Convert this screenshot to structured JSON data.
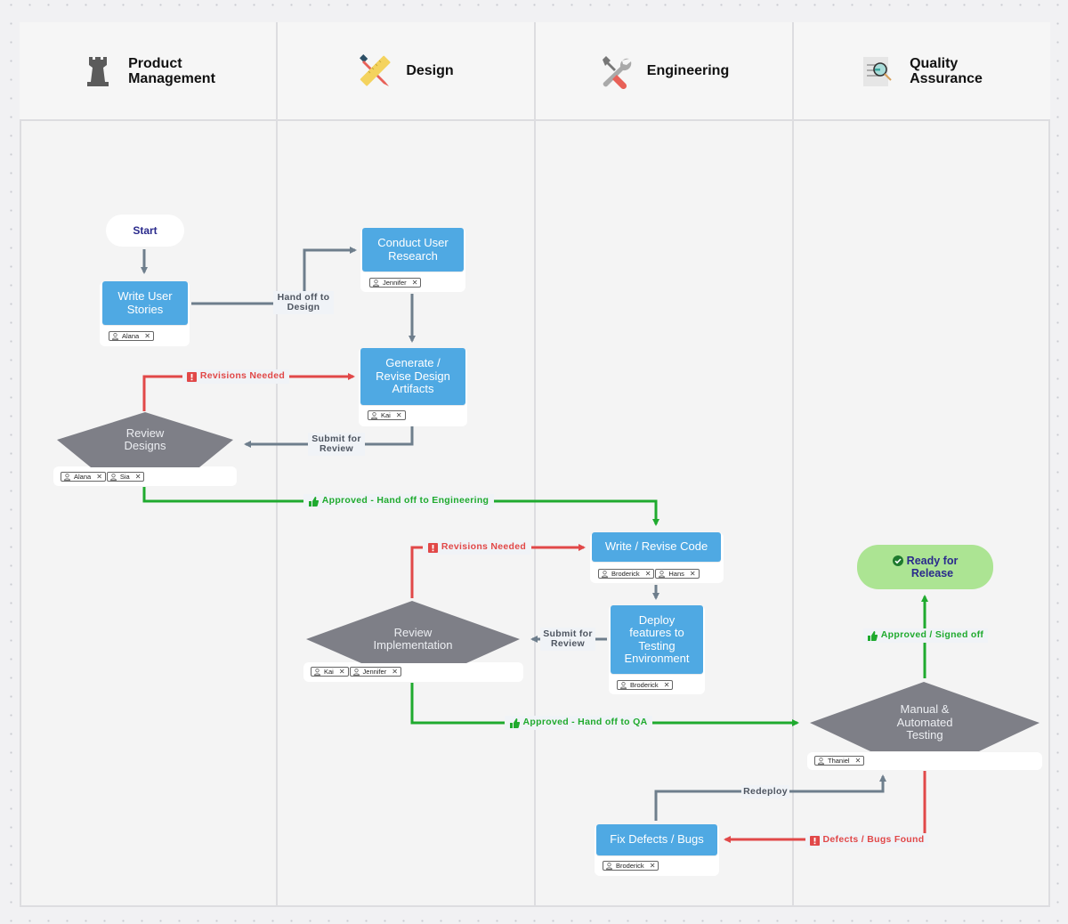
{
  "lanes": [
    {
      "title": "Product\nManagement",
      "icon": "chess-rook-icon"
    },
    {
      "title": "Design",
      "icon": "ruler-pencil-icon"
    },
    {
      "title": "Engineering",
      "icon": "wrench-screwdriver-icon"
    },
    {
      "title": "Quality\nAssurance",
      "icon": "document-magnifier-icon"
    }
  ],
  "colors": {
    "process": "#4fa9e3",
    "decision": "#7e7f87",
    "connector": "#6e7e8c",
    "reject": "#e14848",
    "approve": "#1faa2e",
    "done": "#ace493"
  },
  "nodes": {
    "start": {
      "label": "Start"
    },
    "write_user_stories": {
      "label": "Write User\nStories",
      "assignees": [
        "Alana"
      ]
    },
    "conduct_user_research": {
      "label": "Conduct User\nResearch",
      "assignees": [
        "Jennifer"
      ]
    },
    "generate_design": {
      "label": "Generate /\nRevise Design\nArtifacts",
      "assignees": [
        "Kai"
      ]
    },
    "review_designs": {
      "label": "Review\nDesigns",
      "assignees": [
        "Alana",
        "Sia"
      ]
    },
    "write_code": {
      "label": "Write / Revise Code",
      "assignees": [
        "Broderick",
        "Hans"
      ]
    },
    "deploy_testing": {
      "label": "Deploy\nfeatures to\nTesting\nEnvironment",
      "assignees": [
        "Broderick"
      ]
    },
    "review_implementation": {
      "label": "Review\nImplementation",
      "assignees": [
        "Kai",
        "Jennifer"
      ]
    },
    "testing": {
      "label": "Manual &\nAutomated\nTesting",
      "assignees": [
        "Thaniel"
      ]
    },
    "fix_defects": {
      "label": "Fix Defects / Bugs",
      "assignees": [
        "Broderick"
      ]
    },
    "ready_release": {
      "label": "Ready for\nRelease",
      "icon": "check-circle-icon"
    }
  },
  "edges": {
    "handoff_design": {
      "label": "Hand off to\nDesign"
    },
    "design_revisions": {
      "label": "Revisions Needed",
      "icon": "exclamation-icon"
    },
    "submit_design_review": {
      "label": "Submit for\nReview"
    },
    "approved_engineering": {
      "label": "Approved - Hand off to Engineering",
      "icon": "thumbs-up-icon"
    },
    "code_revisions": {
      "label": "Revisions Needed",
      "icon": "exclamation-icon"
    },
    "submit_impl_review": {
      "label": "Submit for\nReview"
    },
    "approved_qa": {
      "label": "Approved - Hand off to QA",
      "icon": "thumbs-up-icon"
    },
    "approved_signed_off": {
      "label": "Approved / Signed off",
      "icon": "thumbs-up-icon"
    },
    "redeploy": {
      "label": "Redeploy"
    },
    "defects_found": {
      "label": "Defects / Bugs Found",
      "icon": "exclamation-icon"
    }
  }
}
